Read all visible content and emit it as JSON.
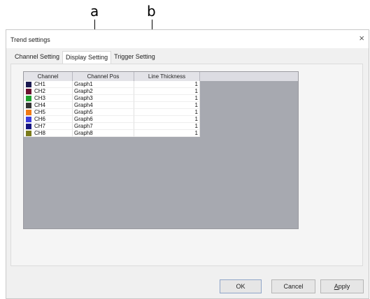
{
  "annotations": {
    "a": "a",
    "b": "b"
  },
  "window": {
    "title": "Trend settings",
    "close_glyph": "×"
  },
  "tabs": [
    {
      "label": "Channel Setting"
    },
    {
      "label": "Display Setting",
      "active": true
    },
    {
      "label": "Trigger Setting"
    }
  ],
  "table": {
    "columns": [
      "Channel",
      "Channel Pos",
      "Line Thickness"
    ],
    "rows": [
      {
        "channel": "CH1",
        "color": "#1a1a50",
        "pos": "Graph1",
        "thickness": "1"
      },
      {
        "channel": "CH2",
        "color": "#6b1030",
        "pos": "Graph2",
        "thickness": "1"
      },
      {
        "channel": "CH3",
        "color": "#1ea02e",
        "pos": "Graph3",
        "thickness": "1"
      },
      {
        "channel": "CH4",
        "color": "#333333",
        "pos": "Graph4",
        "thickness": "1"
      },
      {
        "channel": "CH5",
        "color": "#f07a14",
        "pos": "Graph5",
        "thickness": "1"
      },
      {
        "channel": "CH6",
        "color": "#3c3cdc",
        "pos": "Graph6",
        "thickness": "1"
      },
      {
        "channel": "CH7",
        "color": "#141480",
        "pos": "Graph7",
        "thickness": "1"
      },
      {
        "channel": "CH8",
        "color": "#7a7a1a",
        "pos": "Graph8",
        "thickness": "1"
      }
    ]
  },
  "buttons": {
    "ok": "OK",
    "cancel": "Cancel",
    "apply": "Apply"
  }
}
